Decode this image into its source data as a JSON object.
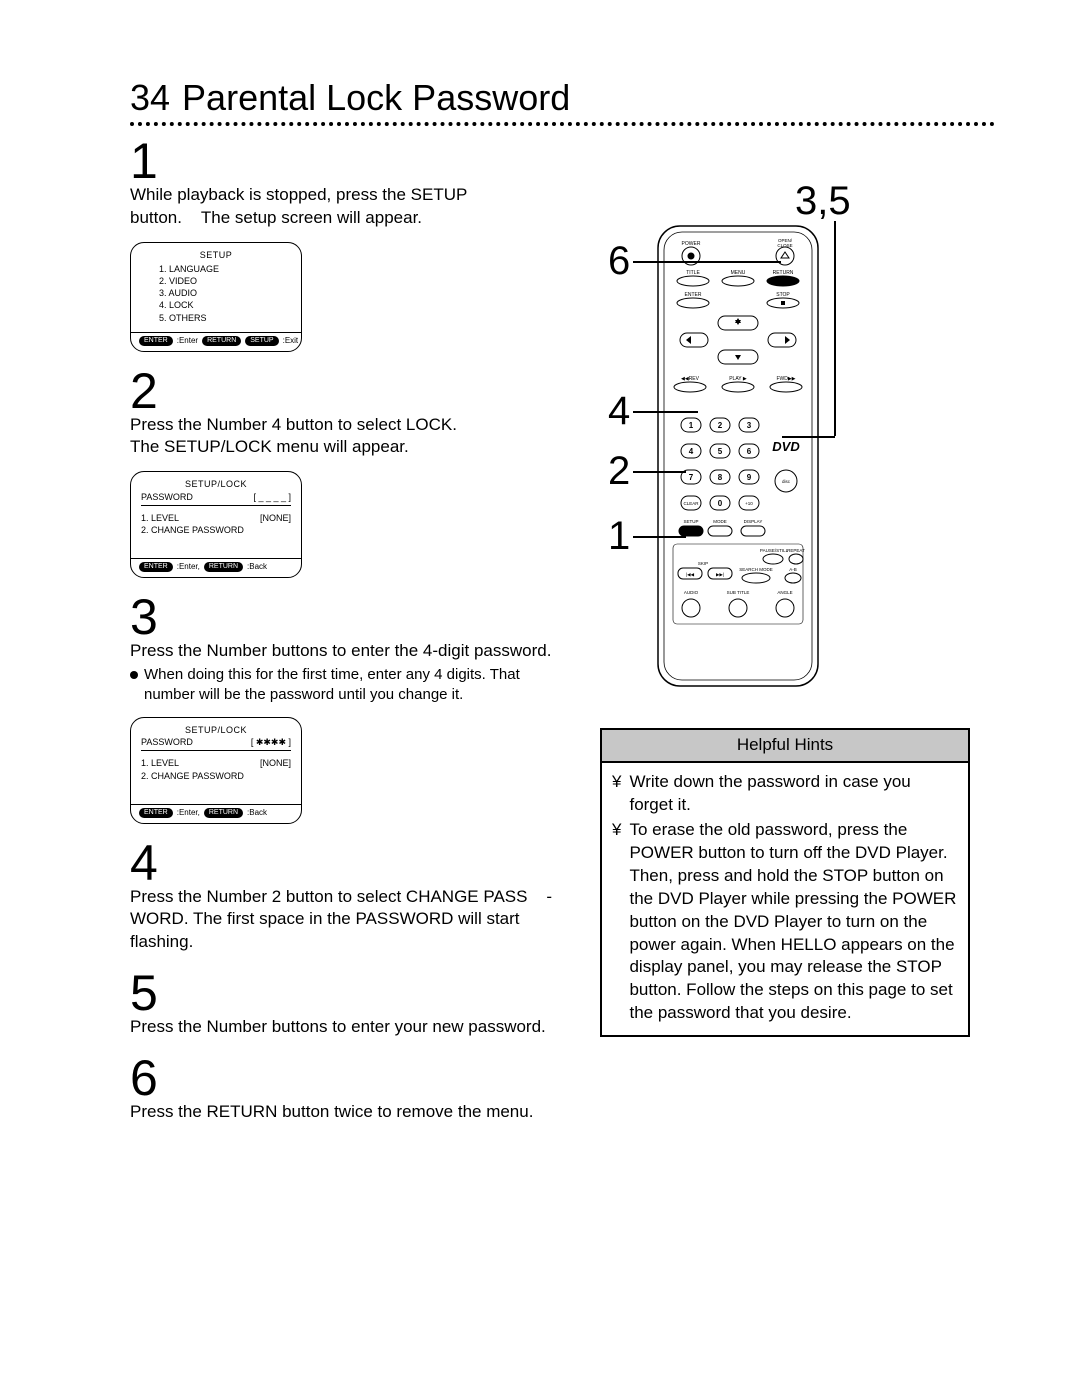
{
  "pageNumber": "34",
  "title": "Parental Lock Password",
  "steps": {
    "1": {
      "num": "1",
      "text": "While playback is stopped, press the SETUP button.",
      "after": "The setup screen will appear."
    },
    "2": {
      "num": "2",
      "text": "Press the Number 4 button to select LOCK.",
      "after": "The SETUP/LOCK menu will appear."
    },
    "3": {
      "num": "3",
      "text": "Press the Number buttons to enter the 4-digit password.",
      "bullet": "When doing this for the first time, enter any 4 digits. That number will be the password until you change it."
    },
    "4": {
      "num": "4",
      "text": "Press the Number 2 button to select CHANGE PASS    -",
      "after": "WORD.  The first space in the PASSWORD will start flashing."
    },
    "5": {
      "num": "5",
      "text": "Press the Number buttons to enter your new password."
    },
    "6": {
      "num": "6",
      "text": "Press the RETURN button twice to remove the menu."
    }
  },
  "osd1": {
    "title": "SETUP",
    "items": [
      "1. LANGUAGE",
      "2. VIDEO",
      "3. AUDIO",
      "4. LOCK",
      "5. OTHERS"
    ],
    "footer": {
      "p1": "ENTER",
      "t1": ":Enter",
      "p2": "RETURN",
      "t2": "",
      "p3": "SETUP",
      "t3": ":Exit"
    }
  },
  "osd2": {
    "title": "SETUP/LOCK",
    "row1_l": "PASSWORD",
    "row1_r": "[ _ _ _ _ ]",
    "row2_l": "1. LEVEL",
    "row2_r": "[NONE]",
    "row3": "2. CHANGE PASSWORD",
    "footer": {
      "p1": "ENTER",
      "t1": ":Enter,",
      "p2": "RETURN",
      "t2": ":Back"
    }
  },
  "osd3": {
    "title": "SETUP/LOCK",
    "row1_l": "PASSWORD",
    "row1_r": "[ ✱✱✱✱ ]",
    "row2_l": "1. LEVEL",
    "row2_r": "[NONE]",
    "row3": "2. CHANGE PASSWORD",
    "footer": {
      "p1": "ENTER",
      "t1": ":Enter,",
      "p2": "RETURN",
      "t2": ":Back"
    }
  },
  "callouts": {
    "c35": "3,5",
    "c6": "6",
    "c4": "4",
    "c2": "2",
    "c1": "1"
  },
  "hints": {
    "title": "Helpful Hints",
    "bullet": "¥",
    "i1": "Write down the password in case you forget it.",
    "i2": "To erase the old password, press the POWER button to turn off the DVD Player. Then, press and hold the STOP button on the DVD Player while pressing the POWER button on the DVD Player to turn on the power again. When  HELLO appears on the display panel, you may release the STOP button. Follow the steps on this page to set the password that you desire."
  },
  "remote": {
    "labels": {
      "power": "POWER",
      "openclose": "OPEN/\nCLOSE",
      "title": "TITLE",
      "menu": "MENU",
      "return": "RETURN",
      "enter": "ENTER",
      "stop": "STOP",
      "rev": "REV",
      "play": "PLAY",
      "fwd": "FWD",
      "n1": "1",
      "n2": "2",
      "n3": "3",
      "n4": "4",
      "n5": "5",
      "n6": "6",
      "n7": "7",
      "n8": "8",
      "n9": "9",
      "n0": "0",
      "clear": "CLEAR",
      "p10": "+10",
      "setup": "SETUP",
      "mode": "MODE",
      "display": "DISPLAY",
      "skip": "SKIP",
      "pausestill": "PAUSE/STILL",
      "repeat": "REPEAT",
      "searchmode": "SEARCH MODE",
      "ab": "A-B",
      "audio": "AUDIO",
      "subtitle": "SUB TITLE",
      "angle": "ANGLE",
      "dvd": "DVD",
      "logo": "logo"
    }
  }
}
